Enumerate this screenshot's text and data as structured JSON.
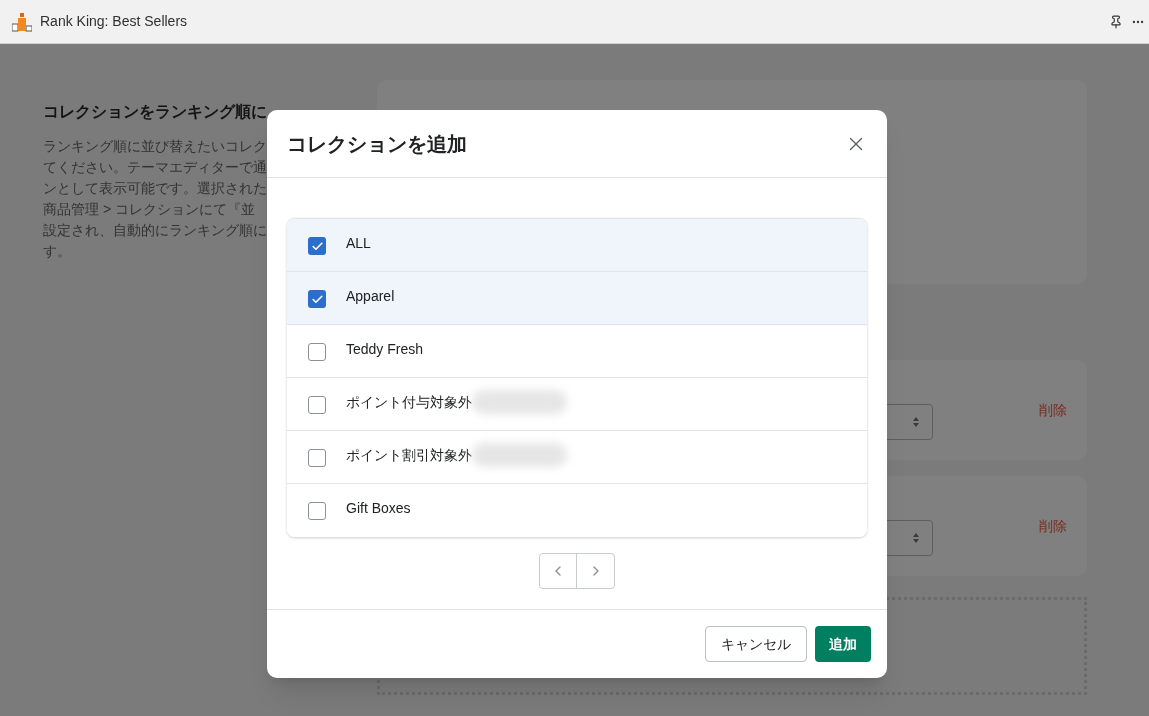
{
  "app_bar": {
    "title": "Rank King: Best Sellers"
  },
  "section": {
    "heading": "コレクションをランキング順に",
    "description_lines": [
      "ランキング順に並び替えたいコレク",
      "てください。テーマエディターで通",
      "ンとして表示可能です。選択された",
      "商品管理 > コレクションにて『並",
      "設定され、自動的にランキング順に",
      "す。"
    ]
  },
  "collection_cards": [
    {
      "delete": "削除"
    },
    {
      "delete": "削除"
    }
  ],
  "modal": {
    "title": "コレクションを追加",
    "items": [
      {
        "label": "ALL",
        "checked": true,
        "redacted": false
      },
      {
        "label": "Apparel",
        "checked": true,
        "redacted": false
      },
      {
        "label": "Teddy Fresh",
        "checked": false,
        "redacted": false
      },
      {
        "label": "ポイント付与対象外",
        "checked": false,
        "redacted": true
      },
      {
        "label": "ポイント割引対象外",
        "checked": false,
        "redacted": true
      },
      {
        "label": "Gift Boxes",
        "checked": false,
        "redacted": false
      }
    ],
    "cancel": "キャンセル",
    "add": "追加"
  }
}
